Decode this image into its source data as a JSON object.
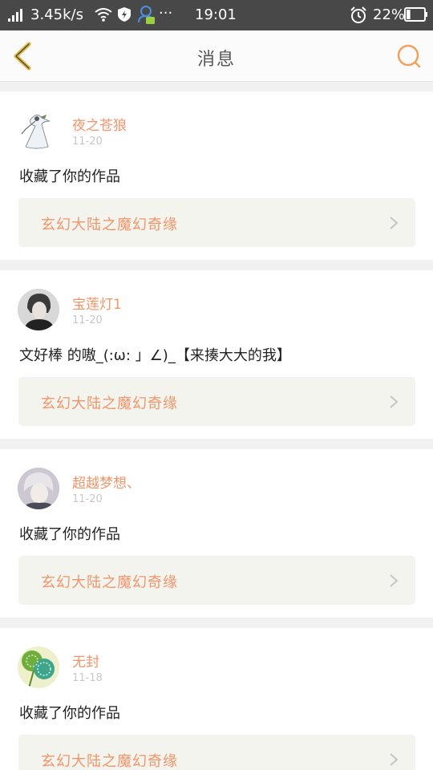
{
  "status_bar": {
    "speed": "3.45k/s",
    "dots": "···",
    "time": "19:01",
    "battery": "22%",
    "battery_level": 0.22
  },
  "header": {
    "title": "消息",
    "accent": "#f0a15c"
  },
  "messages": [
    {
      "name": "夜之苍狼",
      "date": "11-20",
      "text": "收藏了你的作品",
      "work": "玄幻大陆之魔幻奇缘"
    },
    {
      "name": "宝莲灯1",
      "date": "11-20",
      "text": "文好棒 的嗷_(:ω: 」∠)_【来揍大大的我】",
      "work": "玄幻大陆之魔幻奇缘"
    },
    {
      "name": "超越梦想、",
      "date": "11-20",
      "text": "收藏了你的作品",
      "work": "玄幻大陆之魔幻奇缘"
    },
    {
      "name": "无封",
      "date": "11-18",
      "text": "收藏了你的作品",
      "work": "玄幻大陆之魔幻奇缘"
    }
  ],
  "colors": {
    "name": "#f0956a",
    "date": "#c8c8c8",
    "card": "#f4f4ef"
  }
}
